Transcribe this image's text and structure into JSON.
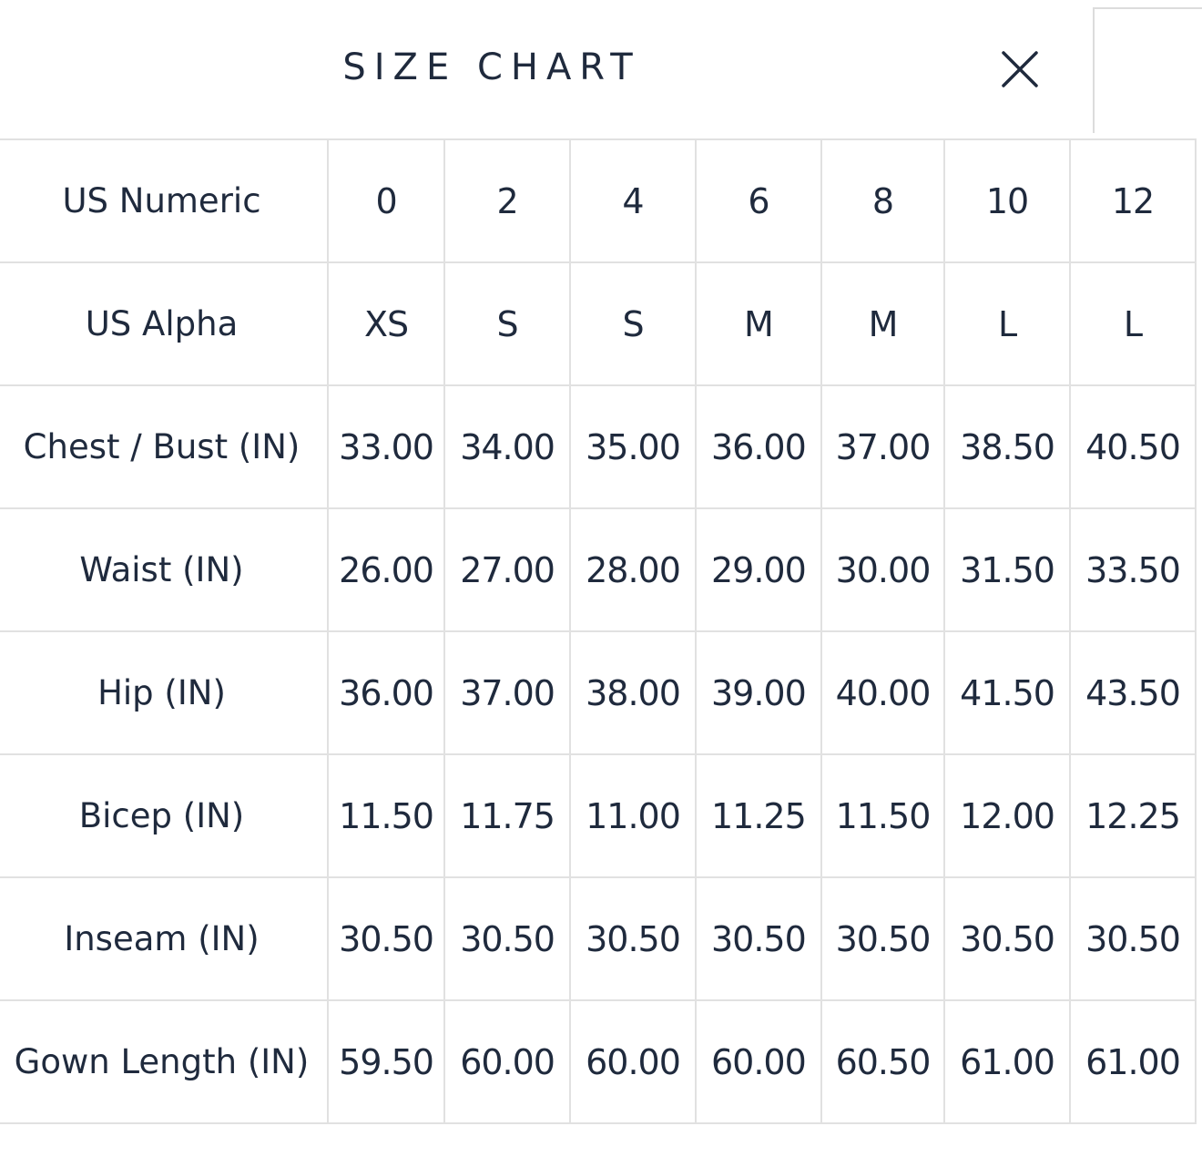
{
  "header": {
    "title": "SIZE CHART",
    "close_icon": "close-icon"
  },
  "size_table": {
    "rows": [
      {
        "label": "US Numeric",
        "values": [
          "0",
          "2",
          "4",
          "6",
          "8",
          "10",
          "12"
        ]
      },
      {
        "label": "US Alpha",
        "values": [
          "XS",
          "S",
          "S",
          "M",
          "M",
          "L",
          "L"
        ]
      },
      {
        "label": "Chest / Bust (IN)",
        "values": [
          "33.00",
          "34.00",
          "35.00",
          "36.00",
          "37.00",
          "38.50",
          "40.50"
        ]
      },
      {
        "label": "Waist (IN)",
        "values": [
          "26.00",
          "27.00",
          "28.00",
          "29.00",
          "30.00",
          "31.50",
          "33.50"
        ]
      },
      {
        "label": "Hip (IN)",
        "values": [
          "36.00",
          "37.00",
          "38.00",
          "39.00",
          "40.00",
          "41.50",
          "43.50"
        ]
      },
      {
        "label": "Bicep (IN)",
        "values": [
          "11.50",
          "11.75",
          "11.00",
          "11.25",
          "11.50",
          "12.00",
          "12.25"
        ]
      },
      {
        "label": "Inseam (IN)",
        "values": [
          "30.50",
          "30.50",
          "30.50",
          "30.50",
          "30.50",
          "30.50",
          "30.50"
        ]
      },
      {
        "label": "Gown Length (IN)",
        "values": [
          "59.50",
          "60.00",
          "60.00",
          "60.00",
          "60.50",
          "61.00",
          "61.00"
        ]
      }
    ]
  }
}
